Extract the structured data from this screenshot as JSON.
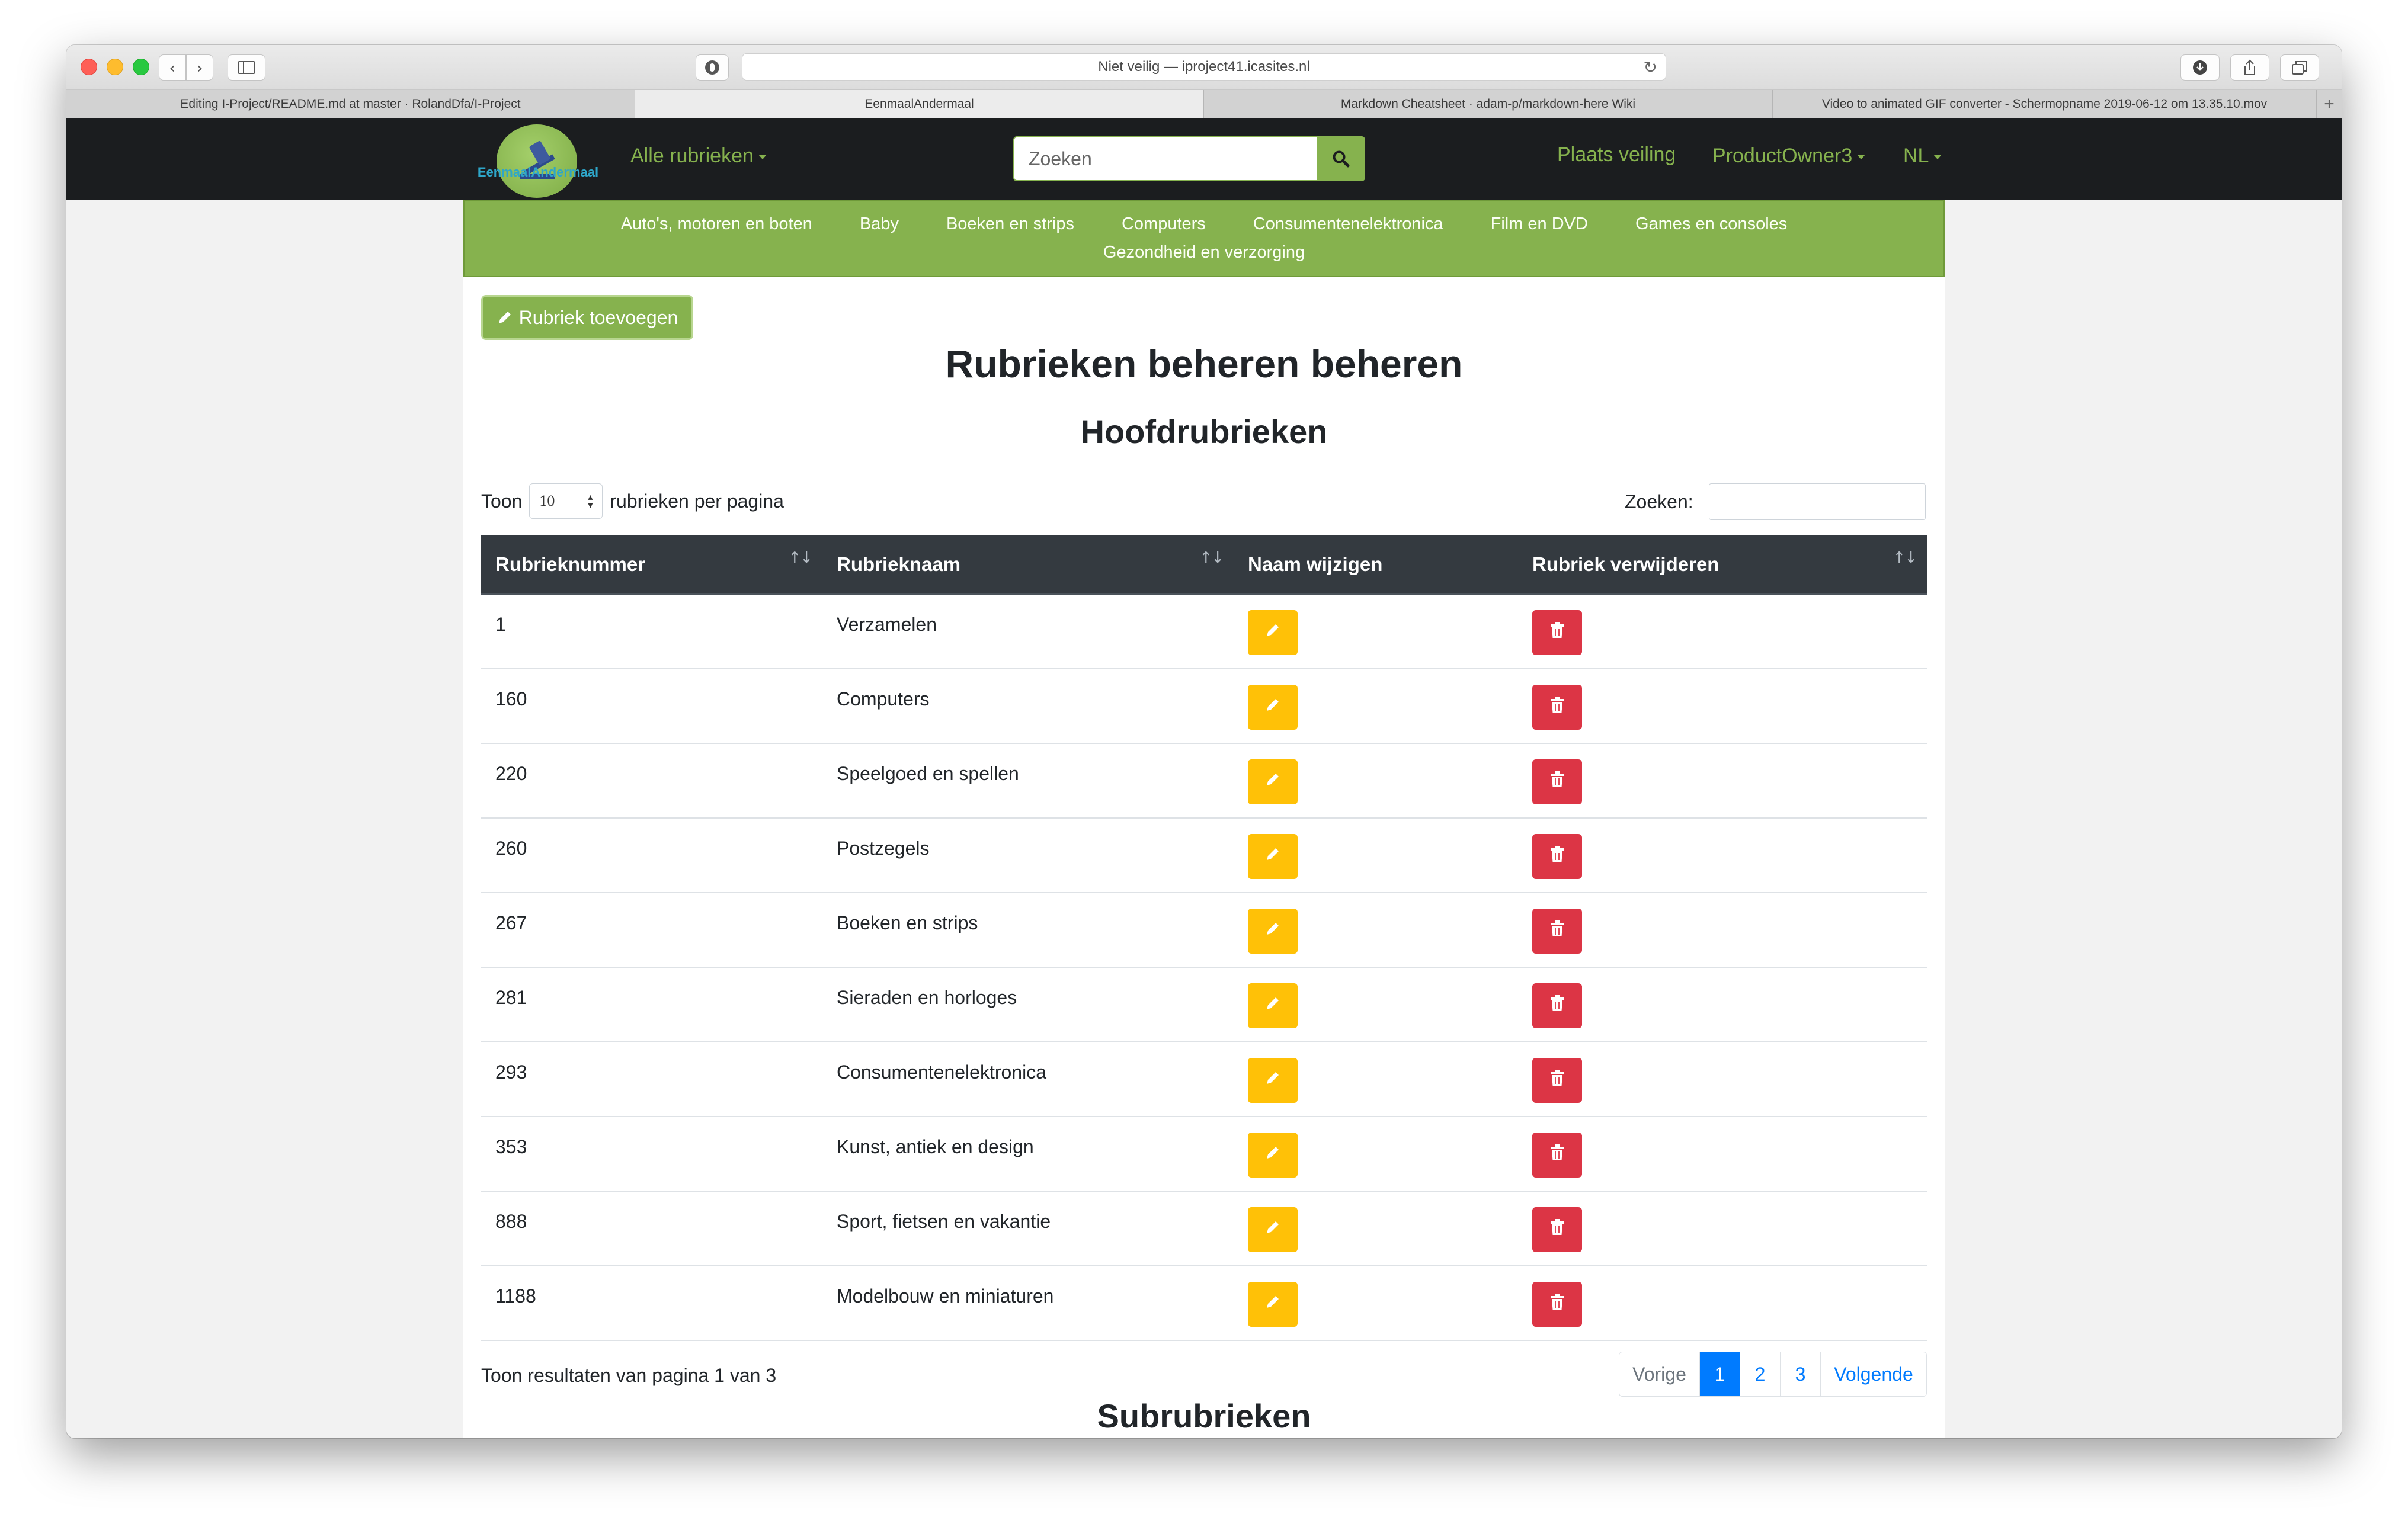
{
  "browser": {
    "address": "Niet veilig — iproject41.icasites.nl",
    "tabs": [
      {
        "label": "Editing I-Project/README.md at master · RolandDfa/I-Project",
        "active": false
      },
      {
        "label": "EenmaalAndermaal",
        "active": true
      },
      {
        "label": "Markdown Cheatsheet · adam-p/markdown-here Wiki",
        "active": false
      },
      {
        "label": "Video to animated GIF converter - Schermopname 2019-06-12 om 13.35.10.mov",
        "active": false
      }
    ]
  },
  "navbar": {
    "logo_text": "EenmaalAndermaal",
    "all_categories": "Alle rubrieken",
    "search_placeholder": "Zoeken",
    "place_auction": "Plaats veiling",
    "user": "ProductOwner3",
    "language": "NL"
  },
  "categories": [
    "Auto's, motoren en boten",
    "Baby",
    "Boeken en strips",
    "Computers",
    "Consumentenelektronica",
    "Film en DVD",
    "Games en consoles",
    "Gezondheid en verzorging"
  ],
  "content": {
    "add_button": "Rubriek toevoegen",
    "title": "Rubrieken beheren beheren",
    "subtitle": "Hoofdrubrieken",
    "show_label": "Toon",
    "page_size": "10",
    "per_page_label": "rubrieken per pagina",
    "search_label": "Zoeken:",
    "pagination_info": "Toon resultaten van pagina 1 van 3",
    "subsection_title": "Subrubrieken"
  },
  "table": {
    "headers": [
      "Rubrieknummer",
      "Rubrieknaam",
      "Naam wijzigen",
      "Rubriek verwijderen"
    ],
    "rows": [
      {
        "number": "1",
        "name": "Verzamelen"
      },
      {
        "number": "160",
        "name": "Computers"
      },
      {
        "number": "220",
        "name": "Speelgoed en spellen"
      },
      {
        "number": "260",
        "name": "Postzegels"
      },
      {
        "number": "267",
        "name": "Boeken en strips"
      },
      {
        "number": "281",
        "name": "Sieraden en horloges"
      },
      {
        "number": "293",
        "name": "Consumentenelektronica"
      },
      {
        "number": "353",
        "name": "Kunst, antiek en design"
      },
      {
        "number": "888",
        "name": "Sport, fietsen en vakantie"
      },
      {
        "number": "1188",
        "name": "Modelbouw en miniaturen"
      }
    ]
  },
  "pagination": {
    "previous": "Vorige",
    "pages": [
      "1",
      "2",
      "3"
    ],
    "current": "1",
    "next": "Volgende"
  },
  "colors": {
    "brand_green": "#86b24e",
    "navbar_bg": "#1b1d1f",
    "edit_yellow": "#ffc107",
    "delete_red": "#dc3545",
    "pagination_blue": "#007bff"
  },
  "icons": [
    "pencil-icon",
    "trash-icon",
    "search-icon",
    "sort-icon",
    "gavel-logo"
  ]
}
